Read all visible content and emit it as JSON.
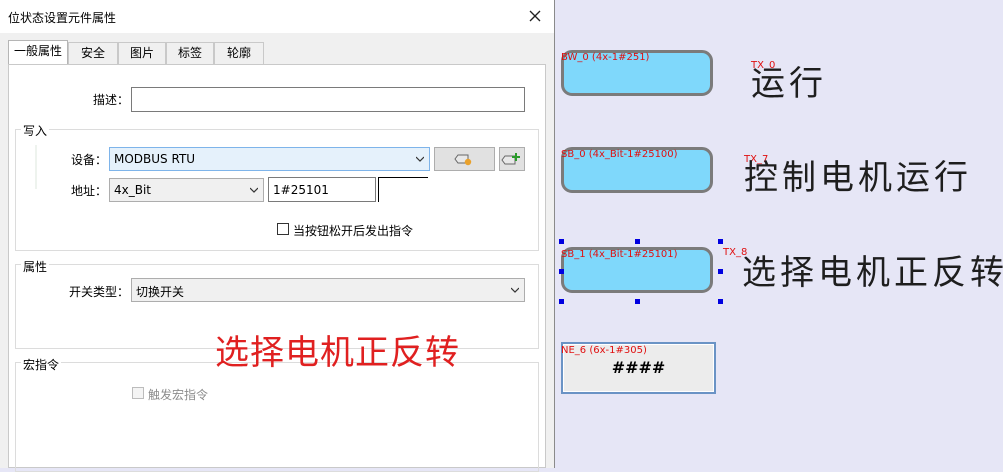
{
  "dialog": {
    "title": "位状态设置元件属性",
    "tabs": [
      "一般属性",
      "安全",
      "图片",
      "标签",
      "轮廓"
    ],
    "description_label": "描述：",
    "description_value": "",
    "write_group": "写入",
    "device_label": "设备：",
    "device_value": "MODBUS RTU",
    "address_label": "地址：",
    "address_type": "4x_Bit",
    "address_value": "1#25101",
    "release_option": "当按钮松开后发出指令",
    "release_checked": false,
    "attribute_group": "属性",
    "switch_type_label": "开关类型：",
    "switch_type_value": "切换开关",
    "macro_group": "宏指令",
    "macro_trigger": "触发宏指令",
    "macro_trigger_enabled": false,
    "overlay_text": "选择电机正反转",
    "overlay_color": "#e02020"
  },
  "canvas": {
    "widgets": [
      {
        "id": "BW_0 (4x-1#251)",
        "tx": "TX_0",
        "label": "运行"
      },
      {
        "id": "SB_0 (4x_Bit-1#25100)",
        "tx": "TX_7",
        "label": "控制电机运行"
      },
      {
        "id": "SB_1 (4x_Bit-1#25101)",
        "tx": "TX_8",
        "label": "选择电机正反转"
      }
    ],
    "numeric": {
      "id": "NE_6 (6x-1#305)",
      "value": "####"
    },
    "button_color": "#7fd8fb",
    "id_color": "#e01010"
  }
}
